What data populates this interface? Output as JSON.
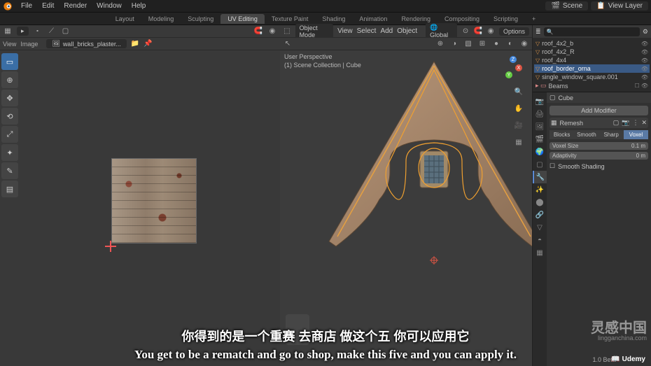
{
  "topbar": {
    "menus": [
      "File",
      "Edit",
      "Render",
      "Window",
      "Help"
    ],
    "scene_label": "Scene",
    "layer_label": "View Layer"
  },
  "workspaces": {
    "tabs": [
      "Layout",
      "Modeling",
      "Sculpting",
      "UV Editing",
      "Texture Paint",
      "Shading",
      "Animation",
      "Rendering",
      "Compositing",
      "Scripting"
    ],
    "active": "UV Editing"
  },
  "uv_editor": {
    "header_menus": [
      "View",
      "Image"
    ],
    "image_name": "wall_bricks_plaster..."
  },
  "viewport": {
    "mode": "Object Mode",
    "header_menus": [
      "View",
      "Select",
      "Add",
      "Object"
    ],
    "orientation": "Global",
    "options": "Options",
    "overlay_line1": "User Perspective",
    "overlay_line2": "(1) Scene Collection | Cube"
  },
  "outliner": {
    "search": "",
    "items": [
      {
        "name": "roof_4x2_b",
        "sel": false
      },
      {
        "name": "roof_4x2_R",
        "sel": false
      },
      {
        "name": "roof_4x4",
        "sel": false
      },
      {
        "name": "roof_border_orna",
        "sel": true
      },
      {
        "name": "single_window_square.001",
        "sel": false
      }
    ],
    "beams": "Beams"
  },
  "properties": {
    "object_name": "Cube",
    "add_modifier": "Add Modifier",
    "modifier_name": "Remesh",
    "mode_tabs": [
      "Blocks",
      "Smooth",
      "Sharp",
      "Voxel"
    ],
    "mode_active": "Voxel",
    "voxel_size_label": "Voxel Size",
    "voxel_size_value": "0.1 m",
    "adaptivity_label": "Adaptivity",
    "adaptivity_value": "0 m",
    "smooth_shading": "Smooth Shading"
  },
  "subtitles": {
    "cn": "你得到的是一个重赛 去商店 做这个五 你可以应用它",
    "en": "You get to be a rematch and go to shop, make this five and you can apply it."
  },
  "watermark": {
    "cn": "灵感中国",
    "url": "lingganchina.com"
  },
  "footer": {
    "beta": "1.0 Beta",
    "udemy": "Udemy"
  }
}
